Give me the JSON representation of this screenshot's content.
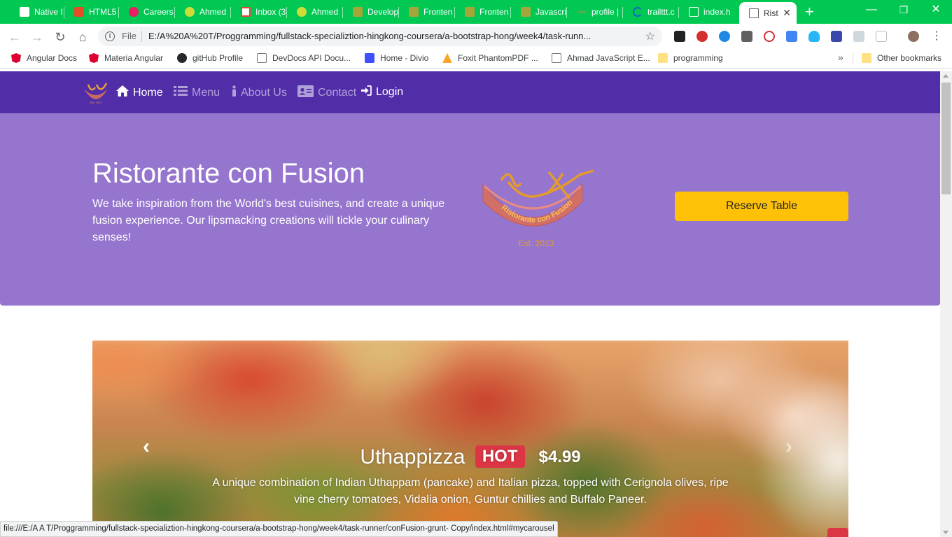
{
  "browser": {
    "tabs": [
      {
        "label": "Native I",
        "color": "#ffffff"
      },
      {
        "label": "HTML5",
        "color": "#e44d26"
      },
      {
        "label": "Careers",
        "color": "#e91e63"
      },
      {
        "label": "Ahmed",
        "color": "#cddc39"
      },
      {
        "label": "Inbox (3",
        "color": "#ea4335"
      },
      {
        "label": "Ahmed",
        "color": "#cddc39"
      },
      {
        "label": "Develop",
        "color": "#a6a63a"
      },
      {
        "label": "Fronten",
        "color": "#a6a63a"
      },
      {
        "label": "Fronten",
        "color": "#a6a63a"
      },
      {
        "label": "Javascri",
        "color": "#a6a63a"
      },
      {
        "label": "profile |",
        "color": "#4caf50"
      },
      {
        "label": "trailttt.c",
        "color": "#1565c0"
      },
      {
        "label": "index.h",
        "color": "#ffffff"
      },
      {
        "label": "Rist",
        "color": "#ffffff"
      }
    ],
    "new_tab": "+",
    "window_controls": {
      "minimize": "—",
      "restore": "❐",
      "close": "✕"
    },
    "tab_close": "✕",
    "address": {
      "scheme": "File",
      "url": "E:/A%20A%20T/Proggramming/fullstack-specializtion-hingkong-coursera/a-bootstrap-hong/week4/task-runn..."
    },
    "bookmarks": [
      {
        "label": "Angular Docs",
        "color": "#dd0031"
      },
      {
        "label": "Materia Angular",
        "color": "#dd0031"
      },
      {
        "label": "gitHub Profile",
        "color": "#24292e"
      },
      {
        "label": "DevDocs API Docu...",
        "color": "#9e9e9e"
      },
      {
        "label": "Home - Divio",
        "color": "#3f51ff"
      },
      {
        "label": "Foxit PhantomPDF ...",
        "color": "#f9a825"
      },
      {
        "label": "Ahmad JavaScript E...",
        "color": "#9e9e9e"
      },
      {
        "label": "programming",
        "color": "#ffe082"
      }
    ],
    "other_bookmarks": "Other bookmarks",
    "status_url": "file:///E:/A A T/Proggramming/fullstack-specializtion-hingkong-coursera/a-bootstrap-hong/week4/task-runner/conFusion-grunt- Copy/index.html#mycarousel"
  },
  "site": {
    "nav": [
      {
        "label": "Home",
        "icon": "home-icon"
      },
      {
        "label": "Menu",
        "icon": "list-icon"
      },
      {
        "label": "About Us",
        "icon": "info-icon"
      },
      {
        "label": "Contact",
        "icon": "address-card-icon"
      }
    ],
    "login": "Login",
    "jumbotron": {
      "title": "Ristorante con Fusion",
      "text": "We take inspiration from the World's best cuisines, and create a unique fusion experience. Our lipsmacking creations will tickle your culinary senses!",
      "reserve_button": "Reserve Table",
      "logo_text": "Ristorante con Fusion",
      "logo_est": "Est. 2013"
    },
    "carousel": {
      "dish": "Uthappizza",
      "badge": "HOT",
      "price": "$4.99",
      "description": "A unique combination of Indian Uthappam (pancake) and Italian pizza, topped with Cerignola olives, ripe vine cherry tomatoes, Vidalia onion, Guntur chillies and Buffalo Paneer."
    }
  },
  "colors": {
    "tab_strip": "#00c853",
    "navbar": "#512da8",
    "jumbotron": "#9575cd",
    "reserve": "#ffc107",
    "badge": "#dc3545"
  }
}
